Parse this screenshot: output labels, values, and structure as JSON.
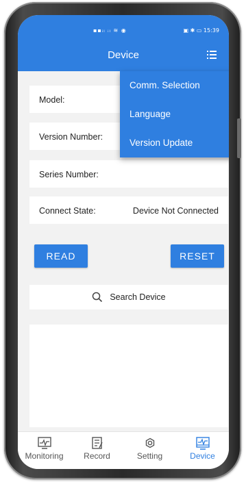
{
  "status_bar": {
    "left": "▪▪ᵢₗ ᵢₗ ≋ ◉",
    "right": "▣ ✱ ▭ 15:39"
  },
  "header": {
    "title": "Device"
  },
  "menu": {
    "items": [
      "Comm. Selection",
      "Language",
      "Version Update"
    ]
  },
  "info": {
    "model_label": "Model:",
    "version_label": "Version Number:",
    "series_label": "Series Number:",
    "connect_label": "Connect State:",
    "connect_value": "Device Not Connected"
  },
  "buttons": {
    "read": "READ",
    "reset": "RESET"
  },
  "search": {
    "label": "Search Device"
  },
  "tabs": [
    {
      "label": "Monitoring",
      "icon": "monitor-icon"
    },
    {
      "label": "Record",
      "icon": "record-icon"
    },
    {
      "label": "Setting",
      "icon": "gear-icon"
    },
    {
      "label": "Device",
      "icon": "device-icon"
    }
  ],
  "colors": {
    "accent": "#2f7fe0",
    "background": "#f2f2f2"
  }
}
